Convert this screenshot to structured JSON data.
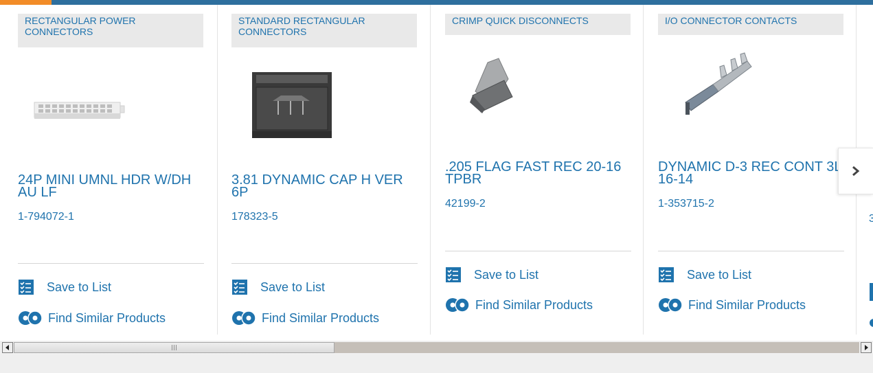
{
  "cards": [
    {
      "category": "RECTANGULAR POWER CONNECTORS",
      "title": "24P MINI UMNL HDR W/DH AU LF",
      "part_number": "1-794072-1",
      "image_icon": "rectangular-power-connector-image"
    },
    {
      "category": "STANDARD RECTANGULAR CONNECTORS",
      "title": "3.81 DYNAMIC CAP H VER 6P",
      "part_number": "178323-5",
      "image_icon": "standard-rectangular-connector-image"
    },
    {
      "category": "CRIMP QUICK DISCONNECTS",
      "title": ".205 FLAG FAST REC 20-16 TPBR",
      "part_number": "42199-2",
      "image_icon": "flag-quick-disconnect-image"
    },
    {
      "category": "I/O CONNECTOR CONTACTS",
      "title": "DYNAMIC D-3 REC CONT 3L 16-14",
      "part_number": "1-353715-2",
      "image_icon": "io-connector-contact-image"
    }
  ],
  "actions": {
    "save_label": "Save to List",
    "similar_label": "Find Similar Products"
  },
  "peek": {
    "part_number_fragment": "3"
  },
  "colors": {
    "link": "#1f73ad",
    "category_bg": "#e9e9e9",
    "top_bar": "#2e6f9e",
    "top_accent": "#f28c28"
  },
  "scrollbar": {
    "position_fraction": 0.0,
    "visible_fraction": 0.38
  }
}
